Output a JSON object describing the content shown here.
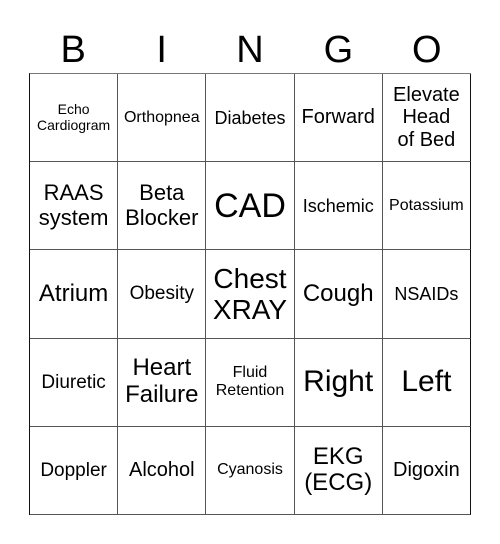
{
  "header": {
    "letters": [
      "B",
      "I",
      "N",
      "G",
      "O"
    ]
  },
  "board": {
    "cells": [
      "Echo\nCardiogram",
      "Orthopnea",
      "Diabetes",
      "Forward",
      "Elevate\nHead\nof Bed",
      "RAAS\nsystem",
      "Beta\nBlocker",
      "CAD",
      "Ischemic",
      "Potassium",
      "Atrium",
      "Obesity",
      "Chest\nXRAY",
      "Cough",
      "NSAIDs",
      "Diuretic",
      "Heart\nFailure",
      "Fluid\nRetention",
      "Right",
      "Left",
      "Doppler",
      "Alcohol",
      "Cyanosis",
      "EKG\n(ECG)",
      "Digoxin"
    ]
  }
}
